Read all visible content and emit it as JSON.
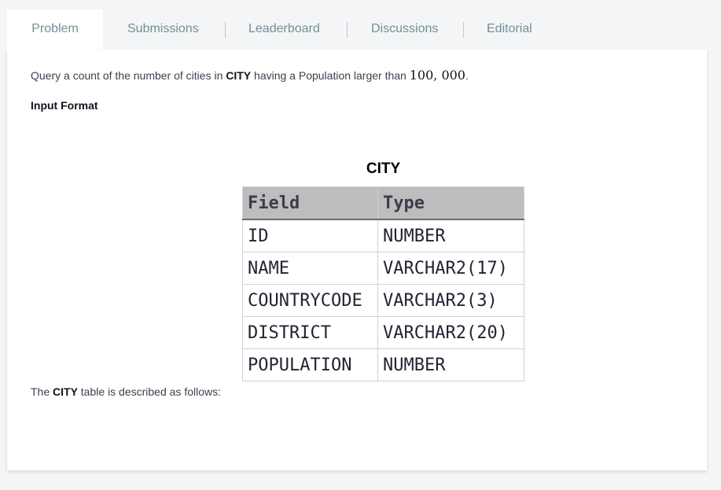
{
  "tabs": [
    {
      "label": "Problem",
      "active": true
    },
    {
      "label": "Submissions",
      "active": false
    },
    {
      "label": "Leaderboard",
      "active": false
    },
    {
      "label": "Discussions",
      "active": false
    },
    {
      "label": "Editorial",
      "active": false
    }
  ],
  "statement": {
    "prefix": "Query a count of the number of cities in ",
    "table_name": "CITY",
    "middle": " having a Population larger than ",
    "number": "100, 000",
    "suffix": "."
  },
  "input_format_heading": "Input Format",
  "city_table": {
    "title": "CITY",
    "headers": [
      "Field",
      "Type"
    ],
    "rows": [
      [
        "ID",
        "NUMBER"
      ],
      [
        "NAME",
        "VARCHAR2(17)"
      ],
      [
        "COUNTRYCODE",
        "VARCHAR2(3)"
      ],
      [
        "DISTRICT",
        "VARCHAR2(20)"
      ],
      [
        "POPULATION",
        "NUMBER"
      ]
    ]
  },
  "description": {
    "prefix": "The ",
    "table_name": "CITY",
    "suffix": " table is described as follows:"
  },
  "colors": {
    "page_background": "#f3f5f7",
    "panel_background": "#ffffff",
    "tab_text": "#738f93",
    "table_header_background": "#bdbdbd"
  }
}
